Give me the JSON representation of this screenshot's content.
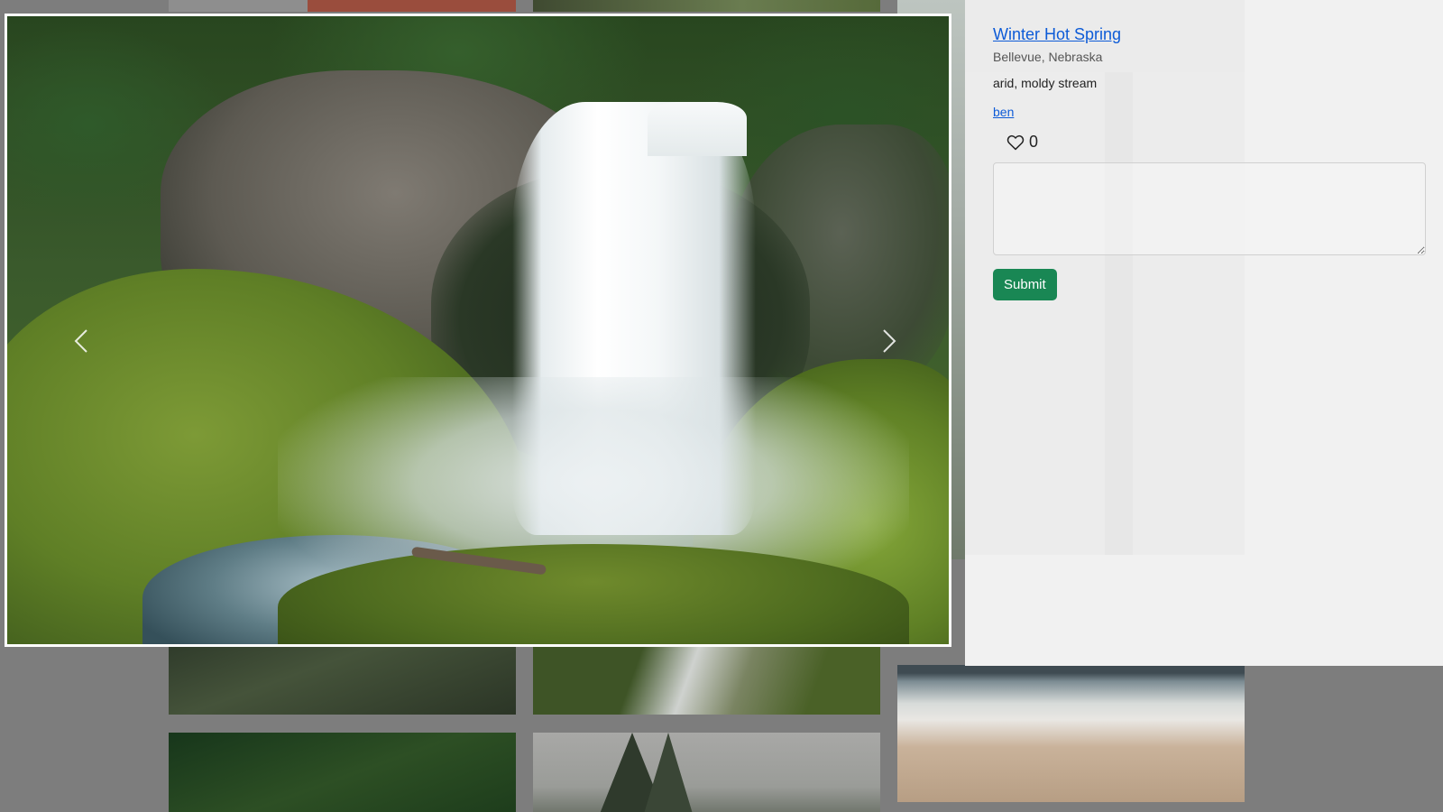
{
  "detail": {
    "title": "Winter Hot Spring",
    "location": "Bellevue, Nebraska",
    "description": "arid, moldy stream",
    "author": "ben",
    "likes": "0",
    "comment_placeholder": "",
    "submit_label": "Submit"
  },
  "icons": {
    "like": "heart-outline-icon",
    "prev": "chevron-left-icon",
    "next": "chevron-right-icon"
  },
  "colors": {
    "link": "#0d5bd7",
    "submit_button": "#198754",
    "panel_background": "#f1f1f1",
    "overlay": "#7d7d7d"
  }
}
